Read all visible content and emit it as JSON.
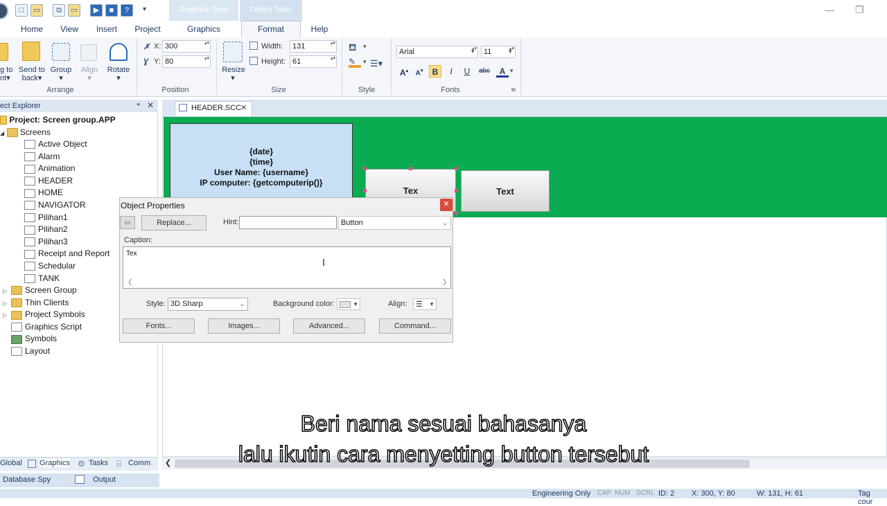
{
  "titlebar": {
    "context_tab_graphics": "Graphics Tools",
    "context_tab_object": "Object Tools",
    "icons": [
      "app-orb-icon",
      "new-icon",
      "open-icon",
      "copy-icon",
      "folder-icon",
      "run-icon",
      "stop-icon",
      "help-icon",
      "dropdown-icon"
    ]
  },
  "tabs": [
    {
      "label": "Home"
    },
    {
      "label": "View"
    },
    {
      "label": "Insert"
    },
    {
      "label": "Project"
    },
    {
      "label": "Graphics"
    },
    {
      "label": "Format"
    },
    {
      "label": "Help"
    }
  ],
  "ribbon": {
    "arrange": {
      "bring_front": "g to\nnt",
      "send_back_1": "Send to",
      "send_back_2": "back",
      "group": "Group",
      "align": "Align",
      "rotate": "Rotate",
      "label": "Arrange"
    },
    "position": {
      "x_label": "X:",
      "x_value": "300",
      "y_label": "Y:",
      "y_value": "80",
      "label": "Position"
    },
    "size": {
      "resize": "Resize",
      "width_label": "Width:",
      "width_value": "131",
      "height_label": "Height:",
      "height_value": "61",
      "label": "Size"
    },
    "style": {
      "label": "Style"
    },
    "fonts": {
      "font_name": "Arial",
      "font_size": "11",
      "label": "Fonts"
    }
  },
  "explorer": {
    "title": "ect Explorer",
    "project": "Project: Screen group.APP",
    "screens_label": "Screens",
    "screens": [
      "Active Object",
      "Alarm",
      "Animation",
      "HEADER",
      "HOME",
      "NAVIGATOR",
      "Pilihan1",
      "Pilihan2",
      "Pilihan3",
      "Receipt and Report",
      "Schedular",
      "TANK"
    ],
    "others": [
      "Screen Group",
      "Thin Clients",
      "Project Symbols",
      "Graphics Script",
      "Symbols",
      "Layout"
    ],
    "bottom_tabs": [
      "Global",
      "Graphics",
      "Tasks",
      "Comm"
    ]
  },
  "output_tabs": [
    "Database Spy",
    "Output"
  ],
  "document": {
    "tab_label": "HEADER.SCC",
    "info_lines": [
      "{date}",
      "{time}",
      "User Name: {username}",
      "IP computer: {getcomputerip()}"
    ],
    "button1": "Tex",
    "button2": "Text",
    "colors": {
      "header_green": "#0bab51",
      "info_blue": "#c7e0f5"
    }
  },
  "dialog": {
    "title": "Object Properties",
    "replace": "Replace...",
    "hint_label": "Hint:",
    "hint_value": "",
    "type_value": "Button",
    "caption_label": "Caption:",
    "caption_value": "Tex",
    "style_label": "Style:",
    "style_value": "3D Sharp",
    "bgcolor_label": "Background color:",
    "align_label": "Align:",
    "fonts_btn": "Fonts...",
    "images_btn": "Images...",
    "advanced_btn": "Advanced...",
    "command_btn": "Command..."
  },
  "status": {
    "engineering": "Engineering Only",
    "cap": "CAP",
    "num": "NUM",
    "scrl": "SCRL",
    "id": "ID: 2",
    "xy": "X: 300, Y: 80",
    "wh": "W: 131, H: 61",
    "tag": "Tag cour"
  },
  "subtitles": {
    "line1": "Beri nama sesuai bahasanya",
    "line2": "lalu ikutin cara menyetting button tersebut"
  }
}
